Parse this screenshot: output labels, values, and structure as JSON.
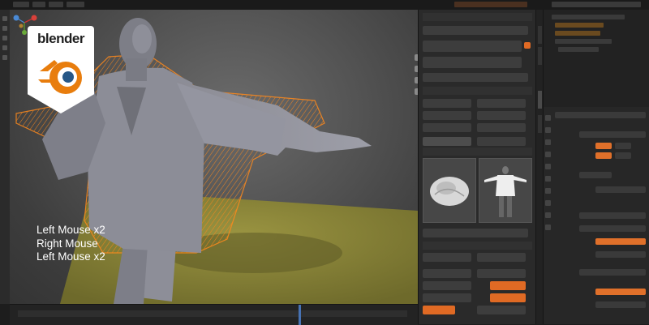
{
  "app": {
    "logo_text": "blender",
    "accent_color": "#e87d0d"
  },
  "viewport": {
    "shortcut_hints": [
      "Left Mouse x2",
      "Right Mouse",
      "Left Mouse x2"
    ],
    "selection_color": "#ff8a1c",
    "floor_color": "#8c8737",
    "icons": [
      "gizmo-axes-icon",
      "zoom-icon",
      "hand-pan-icon",
      "camera-icon",
      "grid-icon"
    ]
  },
  "addon_panel": {
    "thumbnails": [
      "cloth-preview-thumbnail",
      "character-preview-thumbnail"
    ],
    "highlight_color": "#e06a24"
  },
  "properties_panel": {
    "highlight_color": "#e0702a"
  }
}
